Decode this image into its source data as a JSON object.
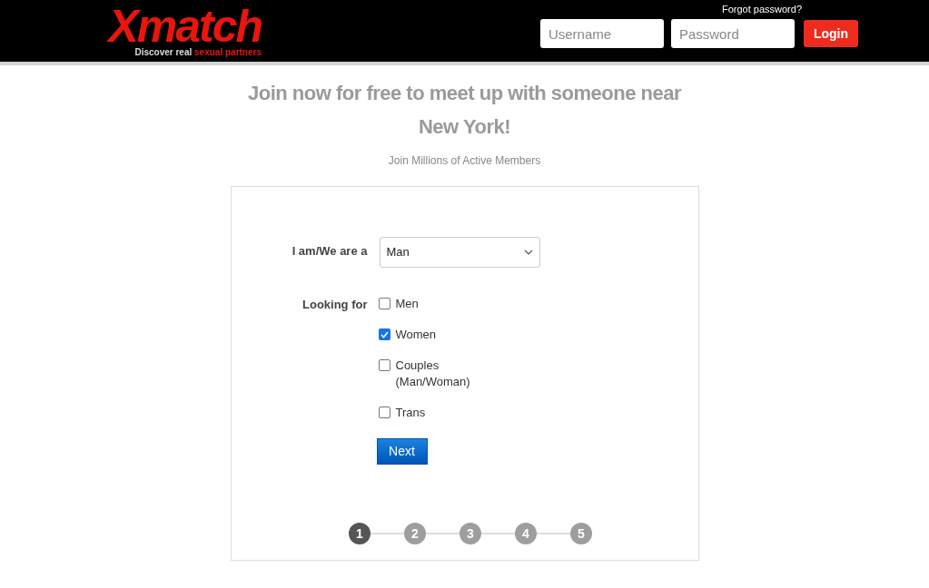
{
  "header": {
    "logo": "Xmatch",
    "tagline_plain": "Discover real",
    "tagline_highlight": "sexual partners",
    "forgot_link": "Forgot password?",
    "username": {
      "placeholder": "Username"
    },
    "password": {
      "placeholder": "Password"
    },
    "login_button": "Login"
  },
  "heading": "Join now for free to meet up with someone near New York!",
  "subtitle": "Join Millions of Active Members",
  "form": {
    "identity": {
      "label": "I am/We are a",
      "value": "Man"
    },
    "looking_for": {
      "label": "Looking for",
      "options": [
        {
          "label": "Men",
          "checked": false
        },
        {
          "label": "Women",
          "checked": true
        },
        {
          "label": "Couples (Man/Woman)",
          "checked": false
        },
        {
          "label": "Trans",
          "checked": false
        }
      ]
    },
    "next_button": "Next",
    "steps": [
      {
        "label": "1",
        "selected": true
      },
      {
        "label": "2",
        "selected": false
      },
      {
        "label": "3",
        "selected": false
      },
      {
        "label": "4",
        "selected": false
      },
      {
        "label": "5",
        "selected": false
      }
    ]
  }
}
